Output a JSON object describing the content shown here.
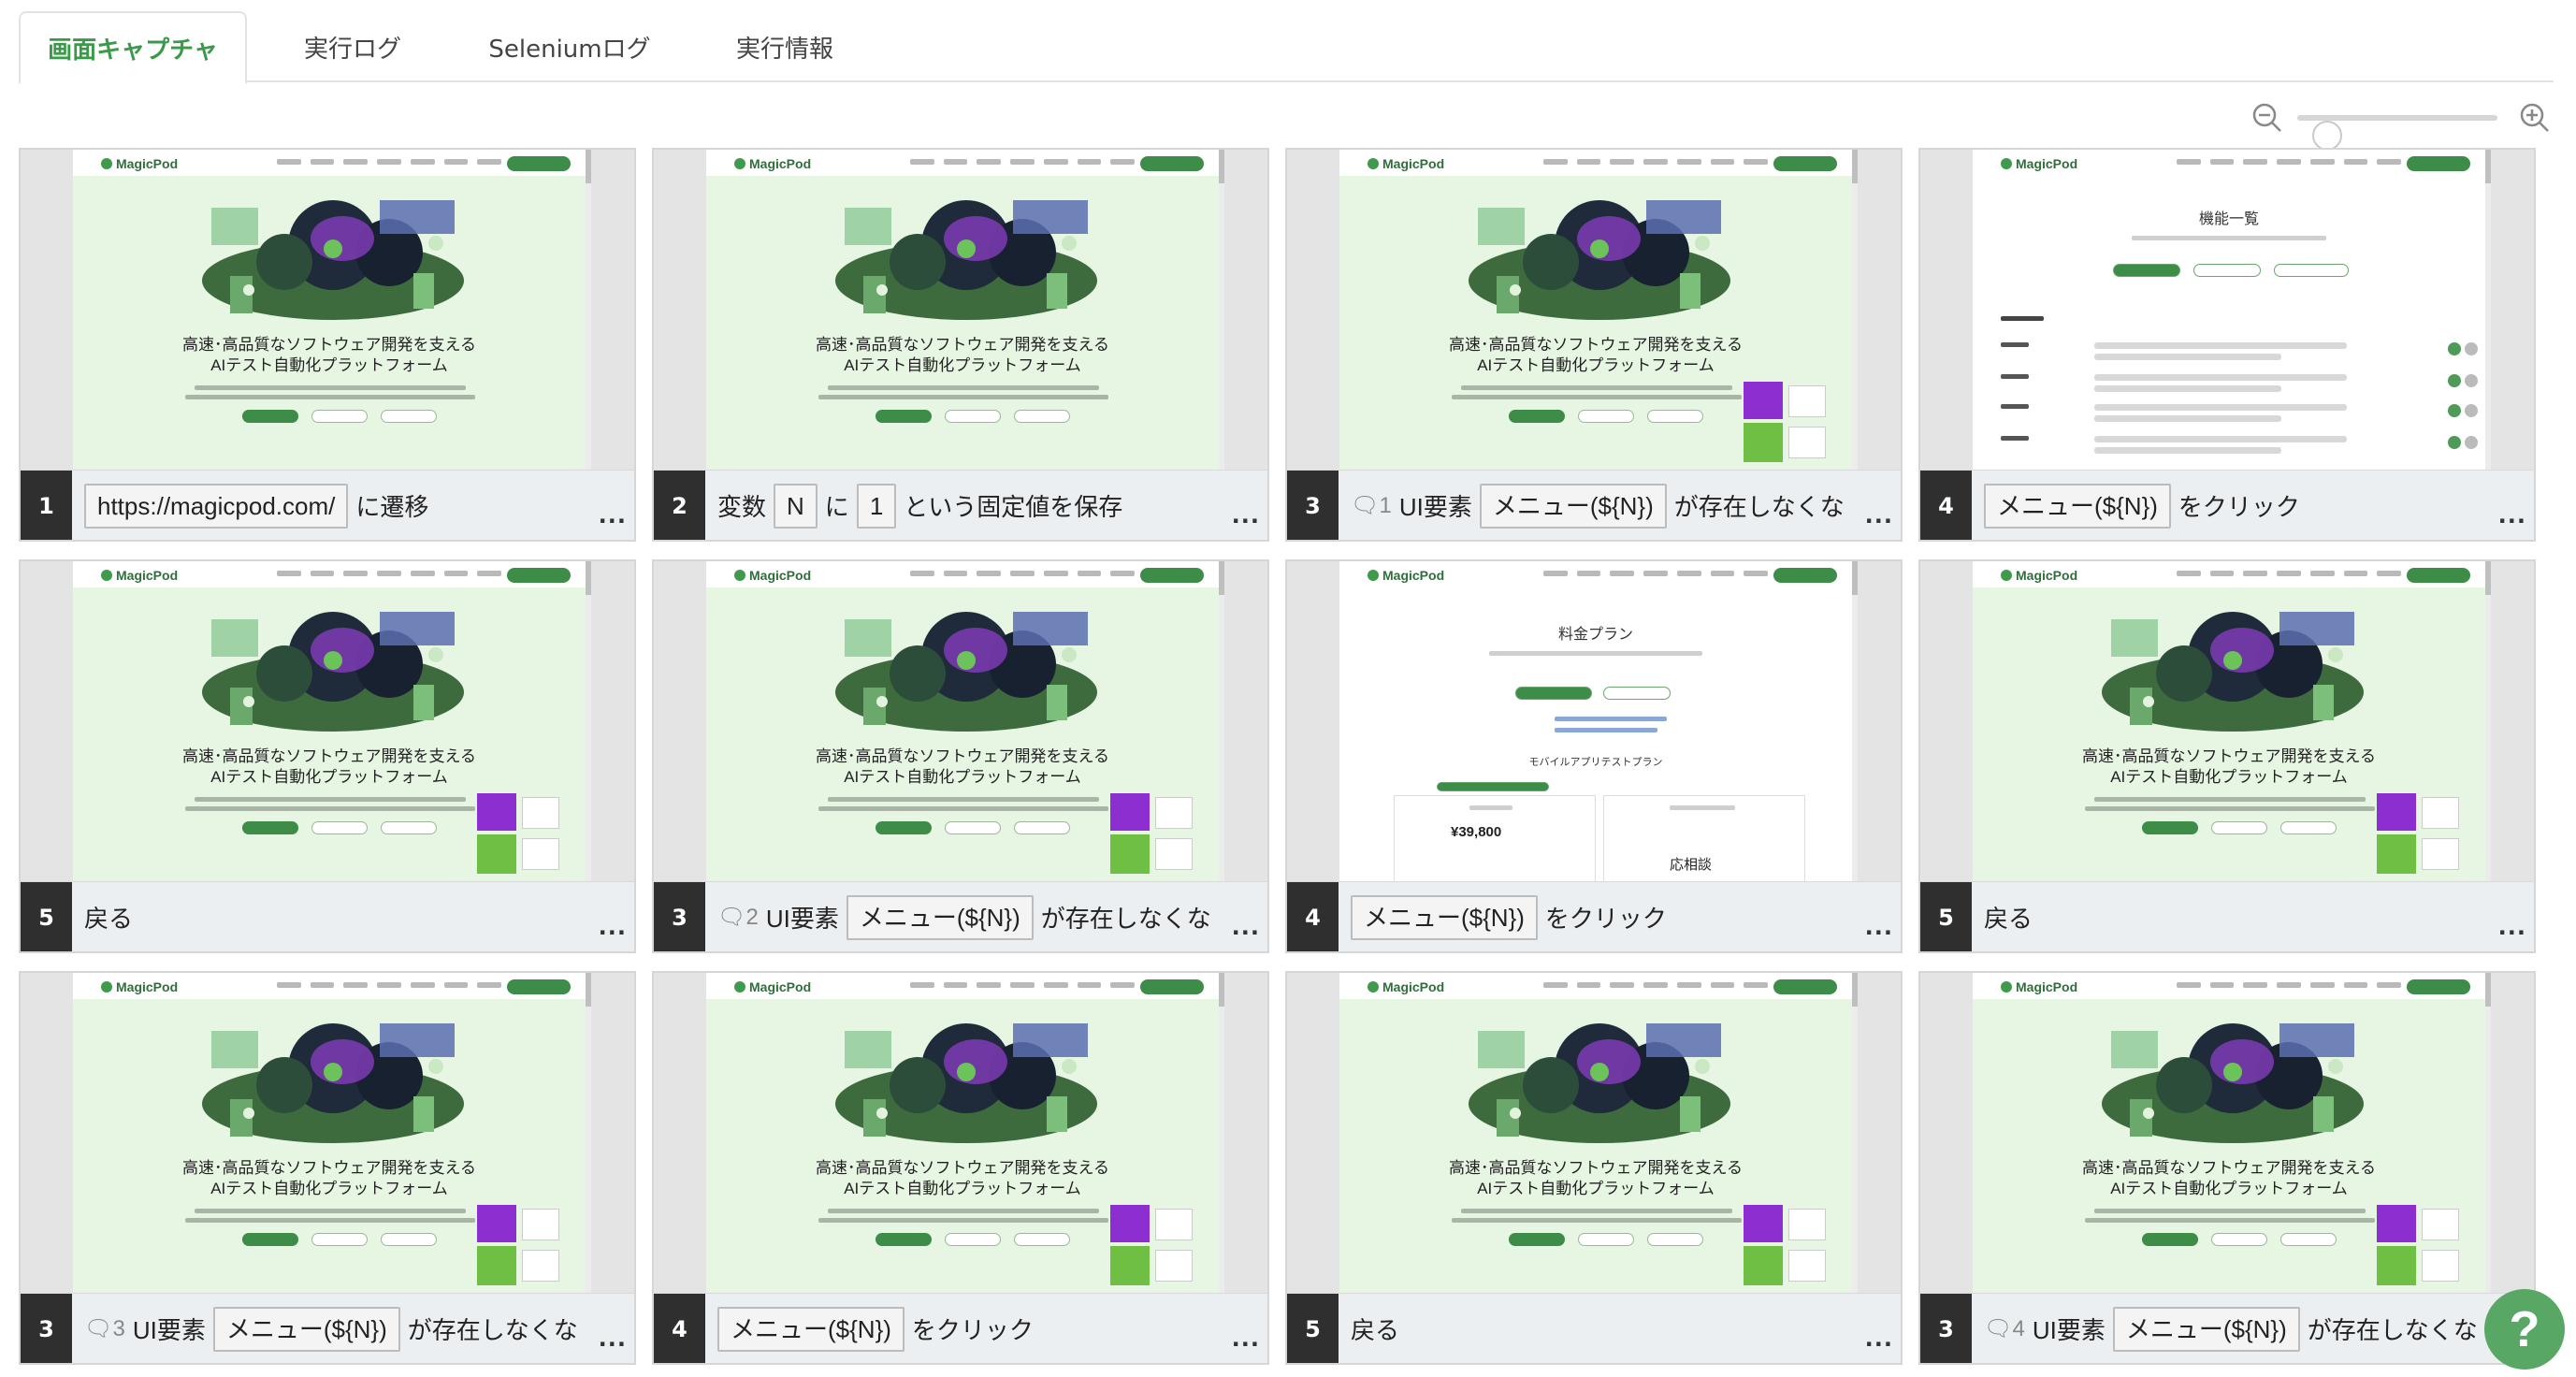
{
  "tabs": [
    {
      "label": "画面キャプチャ",
      "active": true
    },
    {
      "label": "実行ログ",
      "active": false
    },
    {
      "label": "Seleniumログ",
      "active": false
    },
    {
      "label": "実行情報",
      "active": false
    }
  ],
  "zoom": {
    "level_fraction": 0.1
  },
  "screenshot_text": {
    "logo": "MagicPod",
    "hero_line1": "高速･高品質なソフトウェア開発を支える",
    "hero_line2": "AIテスト自動化プラットフォーム",
    "features_title": "機能一覧",
    "pricing_title": "料金プラン",
    "pricing_section": "モバイルアプリテストプラン",
    "price": "¥39,800",
    "consult": "応相談"
  },
  "cards": [
    {
      "num": "1",
      "screen": "hero",
      "ad": false,
      "parts": [
        {
          "t": "box",
          "v": "https://magicpod.com/"
        },
        {
          "t": "text",
          "v": "に遷移"
        }
      ]
    },
    {
      "num": "2",
      "screen": "hero",
      "ad": false,
      "parts": [
        {
          "t": "text",
          "v": "変数"
        },
        {
          "t": "box",
          "v": "N"
        },
        {
          "t": "text",
          "v": "に"
        },
        {
          "t": "box",
          "v": "1"
        },
        {
          "t": "text",
          "v": "という固定値を保存"
        }
      ]
    },
    {
      "num": "3",
      "screen": "hero",
      "ad": true,
      "parts": [
        {
          "t": "bubble",
          "v": "1"
        },
        {
          "t": "text",
          "v": "UI要素"
        },
        {
          "t": "box",
          "v": "メニュー(${N})"
        },
        {
          "t": "text",
          "v": "が存在しなくな"
        }
      ]
    },
    {
      "num": "4",
      "screen": "features",
      "ad": false,
      "parts": [
        {
          "t": "box",
          "v": "メニュー(${N})"
        },
        {
          "t": "text",
          "v": "をクリック"
        }
      ]
    },
    {
      "num": "5",
      "screen": "hero",
      "ad": true,
      "parts": [
        {
          "t": "text",
          "v": "戻る"
        }
      ]
    },
    {
      "num": "3",
      "screen": "hero",
      "ad": true,
      "parts": [
        {
          "t": "bubble",
          "v": "2"
        },
        {
          "t": "text",
          "v": "UI要素"
        },
        {
          "t": "box",
          "v": "メニュー(${N})"
        },
        {
          "t": "text",
          "v": "が存在しなくな"
        }
      ]
    },
    {
      "num": "4",
      "screen": "pricing",
      "ad": false,
      "parts": [
        {
          "t": "box",
          "v": "メニュー(${N})"
        },
        {
          "t": "text",
          "v": "をクリック"
        }
      ]
    },
    {
      "num": "5",
      "screen": "hero",
      "ad": true,
      "parts": [
        {
          "t": "text",
          "v": "戻る"
        }
      ]
    },
    {
      "num": "3",
      "screen": "hero",
      "ad": true,
      "parts": [
        {
          "t": "bubble",
          "v": "3"
        },
        {
          "t": "text",
          "v": "UI要素"
        },
        {
          "t": "box",
          "v": "メニュー(${N})"
        },
        {
          "t": "text",
          "v": "が存在しなくな"
        }
      ]
    },
    {
      "num": "4",
      "screen": "hero",
      "ad": true,
      "parts": [
        {
          "t": "box",
          "v": "メニュー(${N})"
        },
        {
          "t": "text",
          "v": "をクリック"
        }
      ]
    },
    {
      "num": "5",
      "screen": "hero",
      "ad": true,
      "parts": [
        {
          "t": "text",
          "v": "戻る"
        }
      ]
    },
    {
      "num": "3",
      "screen": "hero",
      "ad": true,
      "parts": [
        {
          "t": "bubble",
          "v": "4"
        },
        {
          "t": "text",
          "v": "UI要素"
        },
        {
          "t": "box",
          "v": "メニュー(${N})"
        },
        {
          "t": "text",
          "v": "が存在しなくな"
        }
      ]
    }
  ],
  "more_label": "...",
  "help_label": "?"
}
